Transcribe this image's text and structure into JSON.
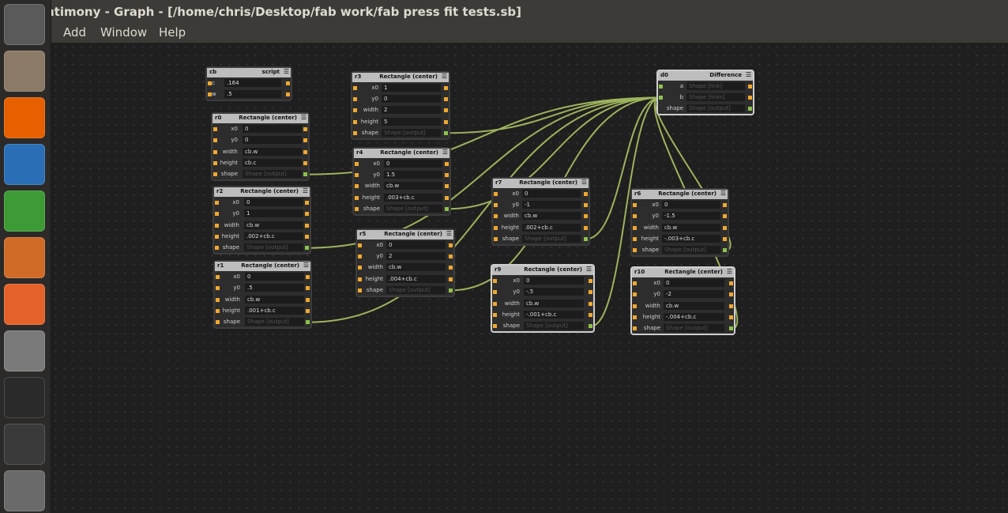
{
  "window": {
    "title": "ntimony - Graph - [/home/chris/Desktop/fab work/fab press fit tests.sb]"
  },
  "menu": [
    "Add",
    "Window",
    "Help"
  ],
  "launcher": [
    {
      "name": "ubuntu-icon",
      "color": "#5a5a5a"
    },
    {
      "name": "files-icon",
      "color": "#8a7a66"
    },
    {
      "name": "firefox-icon",
      "color": "#e66000"
    },
    {
      "name": "writer-icon",
      "color": "#2a6fb5"
    },
    {
      "name": "calc-icon",
      "color": "#3d9b35"
    },
    {
      "name": "impress-icon",
      "color": "#d06a27"
    },
    {
      "name": "software-center-icon",
      "color": "#e4622a"
    },
    {
      "name": "system-settings-icon",
      "color": "#7a7a7a"
    },
    {
      "name": "terminal-icon",
      "color": "#2a2a2a"
    },
    {
      "name": "inkscape-icon",
      "color": "#3a3a3a"
    },
    {
      "name": "gimp-icon",
      "color": "#6a6a6a"
    }
  ],
  "colors": {
    "wire": "#9db35c",
    "input_pin": "#f0a830",
    "output_pin": "#8ec24a"
  },
  "nodes": {
    "cb": {
      "name": "cb",
      "type": "script",
      "rows": [
        {
          "label": "c",
          "value": ".164"
        },
        {
          "label": "w",
          "value": ".5"
        }
      ]
    },
    "r0": {
      "name": "r0",
      "type": "Rectangle (center)",
      "rows": [
        {
          "label": "x0",
          "value": "0"
        },
        {
          "label": "y0",
          "value": "0"
        },
        {
          "label": "width",
          "value": "cb.w"
        },
        {
          "label": "height",
          "value": "cb.c"
        },
        {
          "label": "shape",
          "value": "Shape [output]"
        }
      ]
    },
    "r2": {
      "name": "r2",
      "type": "Rectangle (center)",
      "rows": [
        {
          "label": "x0",
          "value": "0"
        },
        {
          "label": "y0",
          "value": "1"
        },
        {
          "label": "width",
          "value": "cb.w"
        },
        {
          "label": "height",
          "value": ".002+cb.c"
        },
        {
          "label": "shape",
          "value": "Shape [output]"
        }
      ]
    },
    "r1": {
      "name": "r1",
      "type": "Rectangle (center)",
      "rows": [
        {
          "label": "x0",
          "value": "0"
        },
        {
          "label": "y0",
          "value": ".5"
        },
        {
          "label": "width",
          "value": "cb.w"
        },
        {
          "label": "height",
          "value": ".001+cb.c"
        },
        {
          "label": "shape",
          "value": "Shape [output]"
        }
      ]
    },
    "r3": {
      "name": "r3",
      "type": "Rectangle (center)",
      "rows": [
        {
          "label": "x0",
          "value": "1"
        },
        {
          "label": "y0",
          "value": "0"
        },
        {
          "label": "width",
          "value": "2"
        },
        {
          "label": "height",
          "value": "5"
        },
        {
          "label": "shape",
          "value": "Shape [output]"
        }
      ]
    },
    "r4": {
      "name": "r4",
      "type": "Rectangle (center)",
      "rows": [
        {
          "label": "x0",
          "value": "0"
        },
        {
          "label": "y0",
          "value": "1.5"
        },
        {
          "label": "width",
          "value": "cb.w"
        },
        {
          "label": "height",
          "value": ".003+cb.c"
        },
        {
          "label": "shape",
          "value": "Shape [output]"
        }
      ]
    },
    "r5": {
      "name": "r5",
      "type": "Rectangle (center)",
      "rows": [
        {
          "label": "x0",
          "value": "0"
        },
        {
          "label": "y0",
          "value": "2"
        },
        {
          "label": "width",
          "value": "cb.w"
        },
        {
          "label": "height",
          "value": ".004+cb.c"
        },
        {
          "label": "shape",
          "value": "Shape [output]"
        }
      ]
    },
    "r7": {
      "name": "r7",
      "type": "Rectangle (center)",
      "rows": [
        {
          "label": "x0",
          "value": "0"
        },
        {
          "label": "y0",
          "value": "-1"
        },
        {
          "label": "width",
          "value": "cb.w"
        },
        {
          "label": "height",
          "value": ".002+cb.c"
        },
        {
          "label": "shape",
          "value": "Shape [output]"
        }
      ]
    },
    "r9": {
      "name": "r9",
      "type": "Rectangle (center)",
      "rows": [
        {
          "label": "x0",
          "value": "0"
        },
        {
          "label": "y0",
          "value": "-.5"
        },
        {
          "label": "width",
          "value": "cb.w"
        },
        {
          "label": "height",
          "value": "-.001+cb.c"
        },
        {
          "label": "shape",
          "value": "Shape [output]"
        }
      ]
    },
    "d0": {
      "name": "d0",
      "type": "Difference",
      "rows": [
        {
          "label": "a",
          "value": "Shape [link]"
        },
        {
          "label": "b",
          "value": "Shape [links]"
        },
        {
          "label": "shape",
          "value": "Shape [output]"
        }
      ]
    },
    "r6": {
      "name": "r6",
      "type": "Rectangle (center)",
      "rows": [
        {
          "label": "x0",
          "value": "0"
        },
        {
          "label": "y0",
          "value": "-1.5"
        },
        {
          "label": "width",
          "value": "cb.w"
        },
        {
          "label": "height",
          "value": "-.003+cb.c"
        },
        {
          "label": "shape",
          "value": "Shape [output]"
        }
      ]
    },
    "r10": {
      "name": "r10",
      "type": "Rectangle (center)",
      "rows": [
        {
          "label": "x0",
          "value": "0"
        },
        {
          "label": "y0",
          "value": "-2"
        },
        {
          "label": "width",
          "value": "cb.w"
        },
        {
          "label": "height",
          "value": "-.004+cb.c"
        },
        {
          "label": "shape",
          "value": "Shape [output]"
        }
      ]
    }
  }
}
